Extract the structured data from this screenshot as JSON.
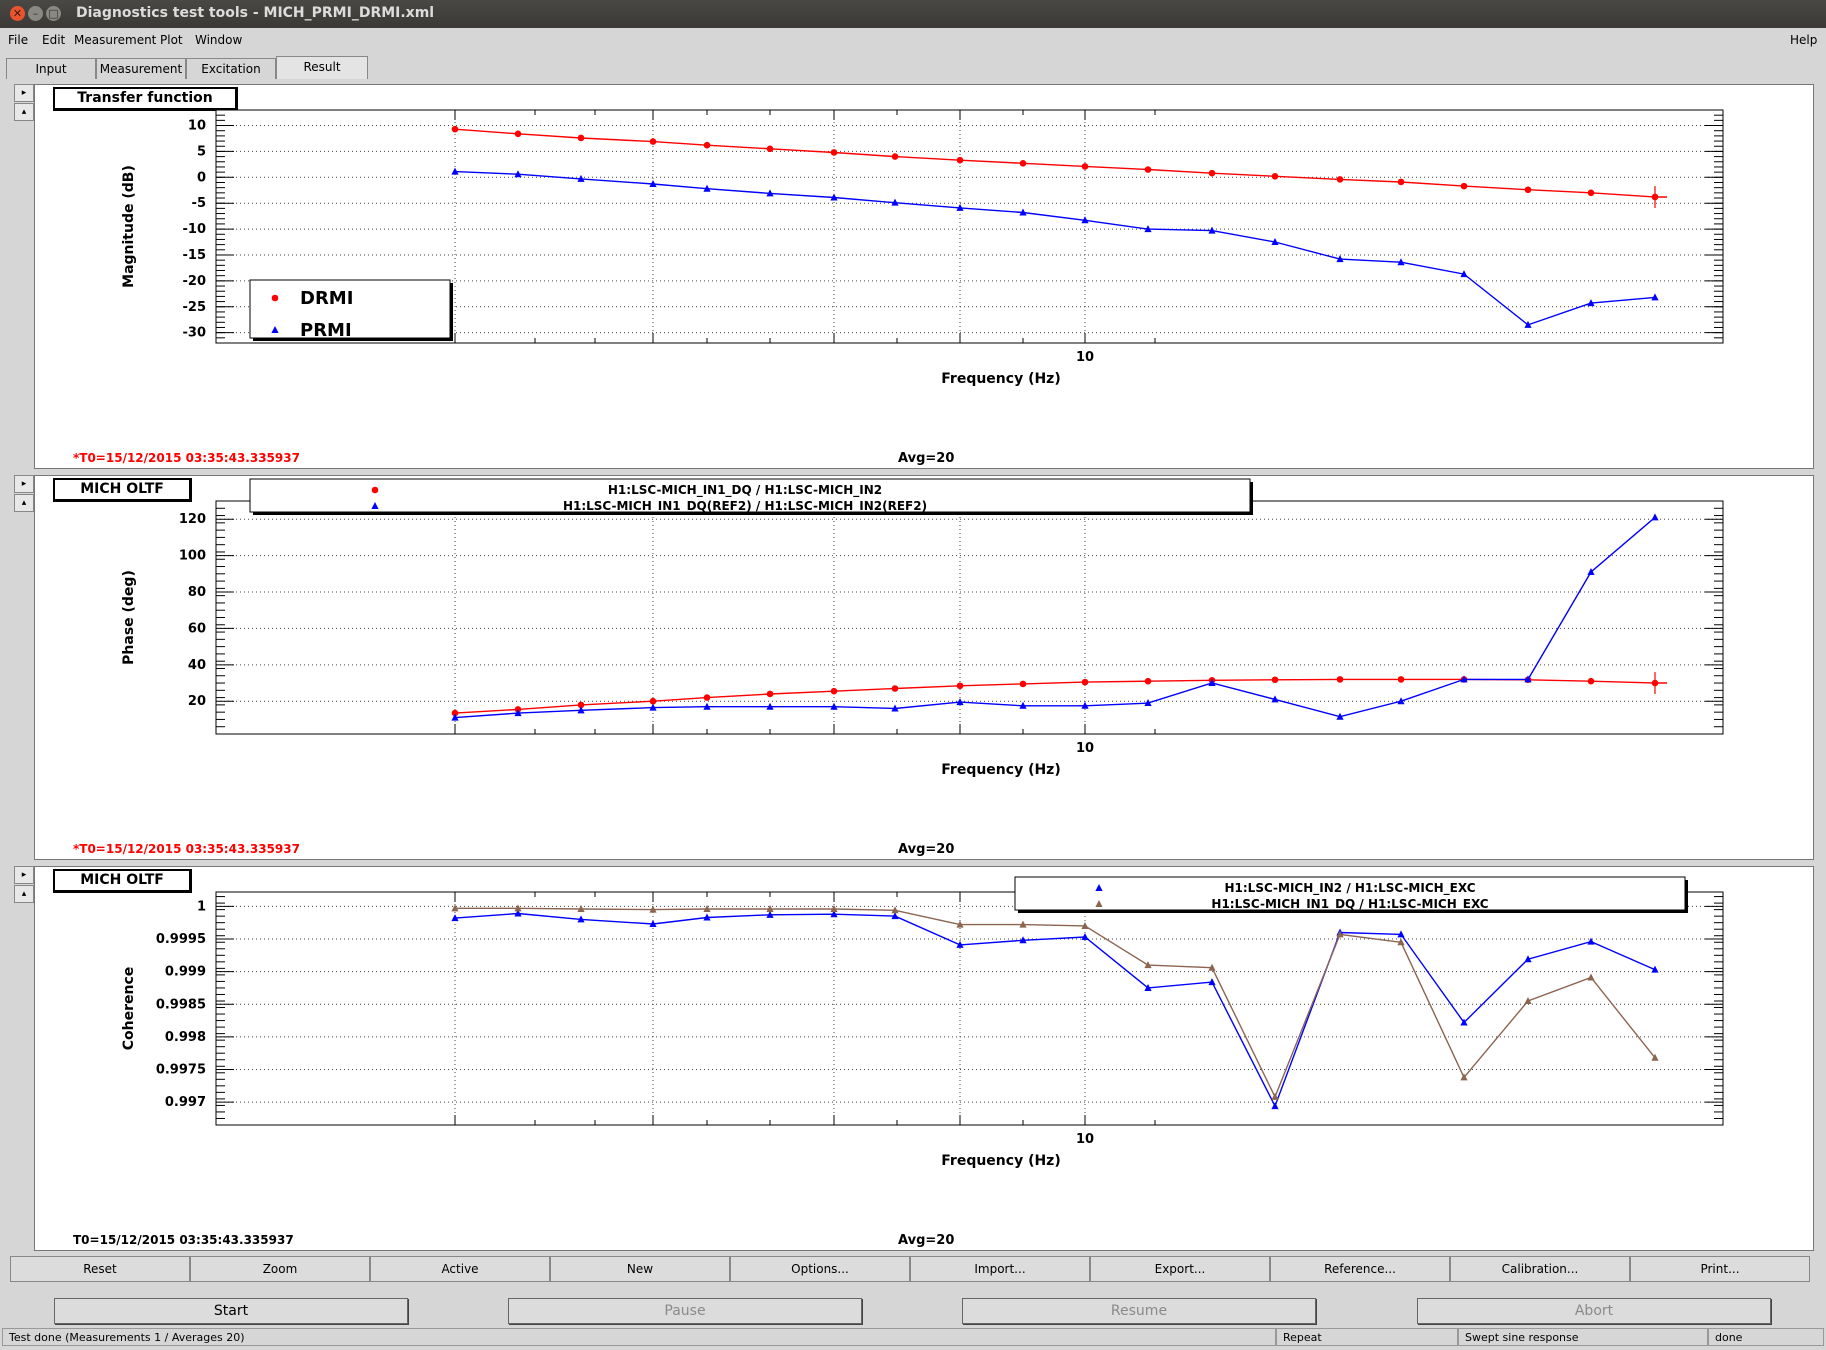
{
  "window": {
    "title": "Diagnostics test tools - MICH_PRMI_DRMI.xml"
  },
  "menu": {
    "items": [
      "File",
      "Edit",
      "Measurement",
      "Plot",
      "Window"
    ],
    "help": "Help"
  },
  "tabs": [
    "Input",
    "Measurement",
    "Excitation",
    "Result"
  ],
  "selected_tab": "Result",
  "panels": [
    {
      "label": "Transfer function",
      "t0": "*T0=15/12/2015 03:35:43.335937",
      "avg": "Avg=20"
    },
    {
      "label": "MICH OLTF",
      "t0": "*T0=15/12/2015 03:35:43.335937",
      "avg": "Avg=20"
    },
    {
      "label": "MICH OLTF",
      "t0": "T0=15/12/2015 03:35:43.335937",
      "avg": "Avg=20"
    }
  ],
  "chart_data": [
    {
      "type": "line",
      "xlabel": "Frequency (Hz)",
      "ylabel": "Magnitude (dB)",
      "xscale": "log",
      "xlim": [
        3.6,
        20
      ],
      "ylim": [
        -32,
        13
      ],
      "yticks": [
        10,
        5,
        0,
        -5,
        -10,
        -15,
        -20,
        -25,
        -30
      ],
      "xtick_labels": [
        "10"
      ],
      "grid": true,
      "legend_placement": "bottom-left",
      "x": [
        5.0,
        5.5,
        6.0,
        6.5,
        7.0,
        7.5,
        8.0,
        8.5,
        9.0,
        9.5,
        10.0,
        10.5,
        11.0,
        11.5,
        12.0,
        12.5,
        13.0,
        13.5
      ],
      "series": [
        {
          "name": "DRMI",
          "color": "#ff0000",
          "marker": "circle",
          "values": [
            9.3,
            8.4,
            7.6,
            6.9,
            6.2,
            5.5,
            4.8,
            4.0,
            3.3,
            2.7,
            2.1,
            1.5,
            0.8,
            0.2,
            -0.4,
            -0.9,
            -1.7,
            -2.4,
            -3.0,
            -3.8
          ]
        },
        {
          "name": "PRMI",
          "color": "#0000ff",
          "marker": "triangle",
          "values": [
            1.1,
            0.6,
            -0.3,
            -1.3,
            -2.2,
            -3.1,
            -3.9,
            -4.9,
            -5.9,
            -6.8,
            -8.3,
            -10.0,
            -10.3,
            -12.5,
            -15.8,
            -16.4,
            -18.7,
            -28.5,
            -24.3,
            -23.2
          ]
        }
      ]
    },
    {
      "type": "line",
      "xlabel": "Frequency (Hz)",
      "ylabel": "Phase (deg)",
      "xscale": "log",
      "xlim": [
        3.6,
        20
      ],
      "ylim": [
        2,
        130
      ],
      "yticks": [
        120,
        100,
        80,
        60,
        40,
        20
      ],
      "xtick_labels": [
        "10"
      ],
      "grid": true,
      "legend_placement": "top-left",
      "series": [
        {
          "name": "H1:LSC-MICH_IN1_DQ / H1:LSC-MICH_IN2",
          "color": "#ff0000",
          "marker": "circle",
          "values": [
            13.5,
            15.5,
            18.0,
            20.0,
            22.0,
            24.0,
            25.5,
            27.0,
            28.5,
            29.5,
            30.5,
            31.0,
            31.5,
            31.8,
            32.0,
            32.0,
            32.0,
            31.8,
            31.0,
            30.0
          ]
        },
        {
          "name": "H1:LSC-MICH_IN1_DQ(REF2) / H1:LSC-MICH_IN2(REF2)",
          "color": "#0000ff",
          "marker": "triangle",
          "values": [
            11.0,
            13.5,
            15.0,
            16.5,
            17.0,
            17.0,
            17.0,
            16.0,
            19.5,
            17.5,
            17.5,
            19.0,
            30.0,
            21.0,
            11.5,
            20.0,
            32.0,
            32.0,
            91.0,
            121.0
          ]
        }
      ]
    },
    {
      "type": "line",
      "xlabel": "Frequency (Hz)",
      "ylabel": "Coherence",
      "xscale": "log",
      "xlim": [
        3.6,
        20
      ],
      "ylim": [
        0.99665,
        1.00022
      ],
      "yticks": [
        "1",
        "0.9995",
        "0.999",
        "0.9985",
        "0.998",
        "0.9975",
        "0.997"
      ],
      "xtick_labels": [
        "10"
      ],
      "grid": true,
      "legend_placement": "top-right",
      "series": [
        {
          "name": "H1:LSC-MICH_IN2 / H1:LSC-MICH_EXC",
          "color": "#0000ff",
          "marker": "triangle",
          "values": [
            0.99982,
            0.99989,
            0.9998,
            0.99973,
            0.99983,
            0.99987,
            0.99988,
            0.99985,
            0.99941,
            0.99948,
            0.99953,
            0.99875,
            0.99884,
            0.99694,
            0.9996,
            0.99957,
            0.99822,
            0.99919,
            0.99946,
            0.99903
          ]
        },
        {
          "name": "H1:LSC-MICH_IN1_DQ / H1:LSC-MICH_EXC",
          "color": "#8b6550",
          "marker": "triangle",
          "values": [
            0.99997,
            0.99997,
            0.99996,
            0.99995,
            0.99996,
            0.99996,
            0.99996,
            0.99994,
            0.99972,
            0.99972,
            0.9997,
            0.9991,
            0.99906,
            0.99708,
            0.99957,
            0.99945,
            0.99738,
            0.99855,
            0.99891,
            0.99768
          ]
        }
      ]
    }
  ],
  "bottom_buttons": [
    "Reset",
    "Zoom",
    "Active",
    "New",
    "Options...",
    "Import...",
    "Export...",
    "Reference...",
    "Calibration...",
    "Print..."
  ],
  "controls": {
    "start": "Start",
    "pause": "Pause",
    "resume": "Resume",
    "abort": "Abort"
  },
  "statusbar": {
    "message": "Test done (Measurements 1 / Averages 20)",
    "mode": "Repeat",
    "type": "Swept sine response",
    "state": "done"
  }
}
